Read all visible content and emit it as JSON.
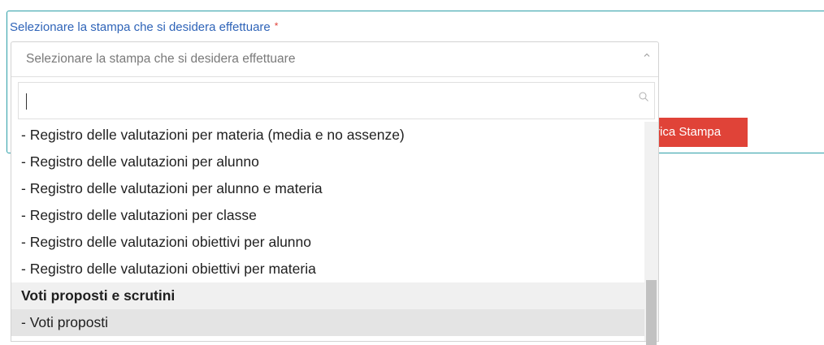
{
  "form": {
    "label": "Selezionare la stampa che si desidera effettuare",
    "required_mark": "*",
    "button_label": "rica Stampa"
  },
  "select": {
    "placeholder": "Selezionare la stampa che si desidera effettuare",
    "search_value": ""
  },
  "options": [
    "- Registro delle valutazioni per materia (media e no assenze)",
    "- Registro delle valutazioni per alunno",
    "- Registro delle valutazioni per alunno e materia",
    "- Registro delle valutazioni per classe",
    "- Registro delle valutazioni obiettivi per alunno",
    "- Registro delle valutazioni obiettivi per materia"
  ],
  "group_header": "Voti proposti e scrutini",
  "highlighted_option": "- Voti proposti",
  "colors": {
    "accent": "#2d9fa8",
    "label": "#2f64b8",
    "button": "#e04338"
  }
}
